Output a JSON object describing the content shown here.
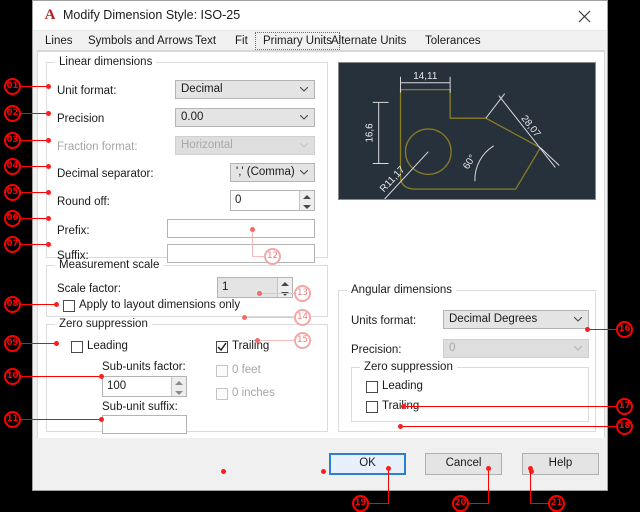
{
  "window": {
    "app_icon": "A",
    "title": "Modify Dimension Style: ISO-25",
    "close_icon": "close-icon"
  },
  "tabs": [
    {
      "label": "Lines",
      "selected": false
    },
    {
      "label": "Symbols and Arrows",
      "selected": false
    },
    {
      "label": "Text",
      "selected": false
    },
    {
      "label": "Fit",
      "selected": false
    },
    {
      "label": "Primary Units",
      "selected": true
    },
    {
      "label": "Alternate Units",
      "selected": false
    },
    {
      "label": "Tolerances",
      "selected": false
    }
  ],
  "linear_dimensions": {
    "legend": "Linear dimensions",
    "unit_format": {
      "label": "Unit format:",
      "value": "Decimal"
    },
    "precision": {
      "label": "Precision",
      "value": "0.00"
    },
    "fraction_format": {
      "label": "Fraction format:",
      "value": "Horizontal",
      "disabled": true
    },
    "decimal_separator": {
      "label": "Decimal separator:",
      "value": "',' (Comma)"
    },
    "round_off": {
      "label": "Round off:",
      "value": "0"
    },
    "prefix": {
      "label": "Prefix:",
      "value": "",
      "placeholder": ""
    },
    "suffix": {
      "label": "Suffix:",
      "value": "",
      "placeholder": ""
    }
  },
  "measurement_scale": {
    "legend": "Measurement scale",
    "scale_factor": {
      "label": "Scale factor:",
      "value": "1"
    },
    "apply_layout_only": {
      "label": "Apply to layout dimensions only",
      "checked": false
    }
  },
  "zero_suppression_linear": {
    "legend": "Zero suppression",
    "leading": {
      "label": "Leading",
      "checked": false
    },
    "trailing": {
      "label": "Trailing",
      "checked": true
    },
    "feet": {
      "label": "0 feet",
      "checked": false,
      "disabled": true
    },
    "inches": {
      "label": "0 inches",
      "checked": false,
      "disabled": true
    },
    "sub_units_factor": {
      "label": "Sub-units factor:",
      "value": "100"
    },
    "sub_unit_suffix": {
      "label": "Sub-unit suffix:",
      "value": "",
      "placeholder": ""
    }
  },
  "angular_dimensions": {
    "legend": "Angular dimensions",
    "units_format": {
      "label": "Units format:",
      "value": "Decimal Degrees"
    },
    "precision": {
      "label": "Precision:",
      "value": "0",
      "disabled": true
    },
    "zero_suppression": {
      "legend": "Zero suppression",
      "leading": {
        "label": "Leading",
        "checked": false
      },
      "trailing": {
        "label": "Trailing",
        "checked": false
      }
    }
  },
  "preview": {
    "name": "dimension-style-preview",
    "background": "#27313b",
    "geometry_color": "#8a7d22",
    "dimension_color": "#d9d9d9",
    "labels": [
      {
        "text": "14,11",
        "kind": "horizontal-dimension"
      },
      {
        "text": "16,6",
        "kind": "vertical-dimension"
      },
      {
        "text": "28,07",
        "kind": "aligned-dimension"
      },
      {
        "text": "60°",
        "kind": "angular-dimension"
      },
      {
        "text": "R11,17",
        "kind": "radius-dimension"
      }
    ]
  },
  "footer": {
    "ok": "OK",
    "cancel": "Cancel",
    "help": "Help"
  },
  "callouts": {
    "c01": "01",
    "c02": "02",
    "c03": "03",
    "c04": "04",
    "c05": "05",
    "c06": "06",
    "c07": "07",
    "c08": "08",
    "c09": "09",
    "c10": "10",
    "c11": "11",
    "c12": "12",
    "c13": "13",
    "c14": "14",
    "c15": "15",
    "c16": "16",
    "c17": "17",
    "c18": "18",
    "c19": "19",
    "c20": "20",
    "c21": "21"
  },
  "colors": {
    "callout_red": "#ff0000",
    "callout_pale": "#f7b9b9",
    "dialog_bg": "#f0f0f0",
    "panel_bg": "#ffffff",
    "default_button_border": "#2f7fd0"
  }
}
